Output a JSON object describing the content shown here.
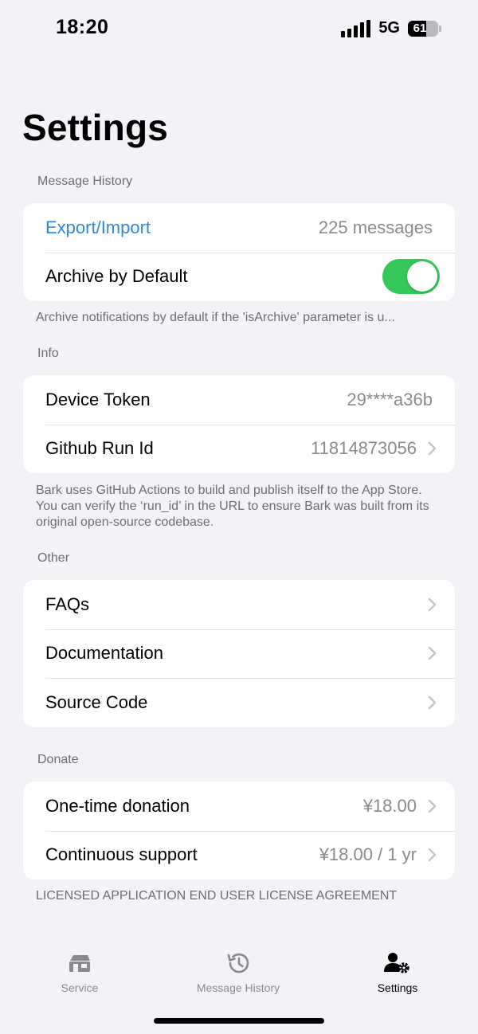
{
  "status_bar": {
    "time": "18:20",
    "network": "5G",
    "battery": "61",
    "battery_level": 0.61
  },
  "page": {
    "title": "Settings"
  },
  "sections": {
    "message_history": {
      "header": "Message History",
      "export_label": "Export/Import",
      "export_value": "225 messages",
      "archive_label": "Archive by Default",
      "archive_enabled": true,
      "footer": "Archive notifications by default if the 'isArchive' parameter is u..."
    },
    "info": {
      "header": "Info",
      "device_token_label": "Device Token",
      "device_token_value": "29****a36b",
      "run_id_label": "Github Run Id",
      "run_id_value": "11814873056",
      "footer": "Bark uses GitHub Actions to build and publish itself to the App Store. You can verify the ‘run_id’ in the URL to ensure Bark was built from its original open-source codebase."
    },
    "other": {
      "header": "Other",
      "items": [
        "FAQs",
        "Documentation",
        "Source Code"
      ]
    },
    "donate": {
      "header": "Donate",
      "one_time_label": "One-time donation",
      "one_time_value": "¥18.00",
      "continuous_label": "Continuous support",
      "continuous_value": "¥18.00 / 1 yr",
      "footer": "LICENSED APPLICATION END USER LICENSE AGREEMENT"
    }
  },
  "tab_bar": {
    "tabs": [
      {
        "label": "Service",
        "icon": "service-icon",
        "active": false
      },
      {
        "label": "Message History",
        "icon": "history-icon",
        "active": false
      },
      {
        "label": "Settings",
        "icon": "person-gear-icon",
        "active": true
      }
    ]
  },
  "colors": {
    "accent_link": "#2f87d8",
    "toggle_on": "#34c759",
    "background": "#f2f2f7"
  }
}
